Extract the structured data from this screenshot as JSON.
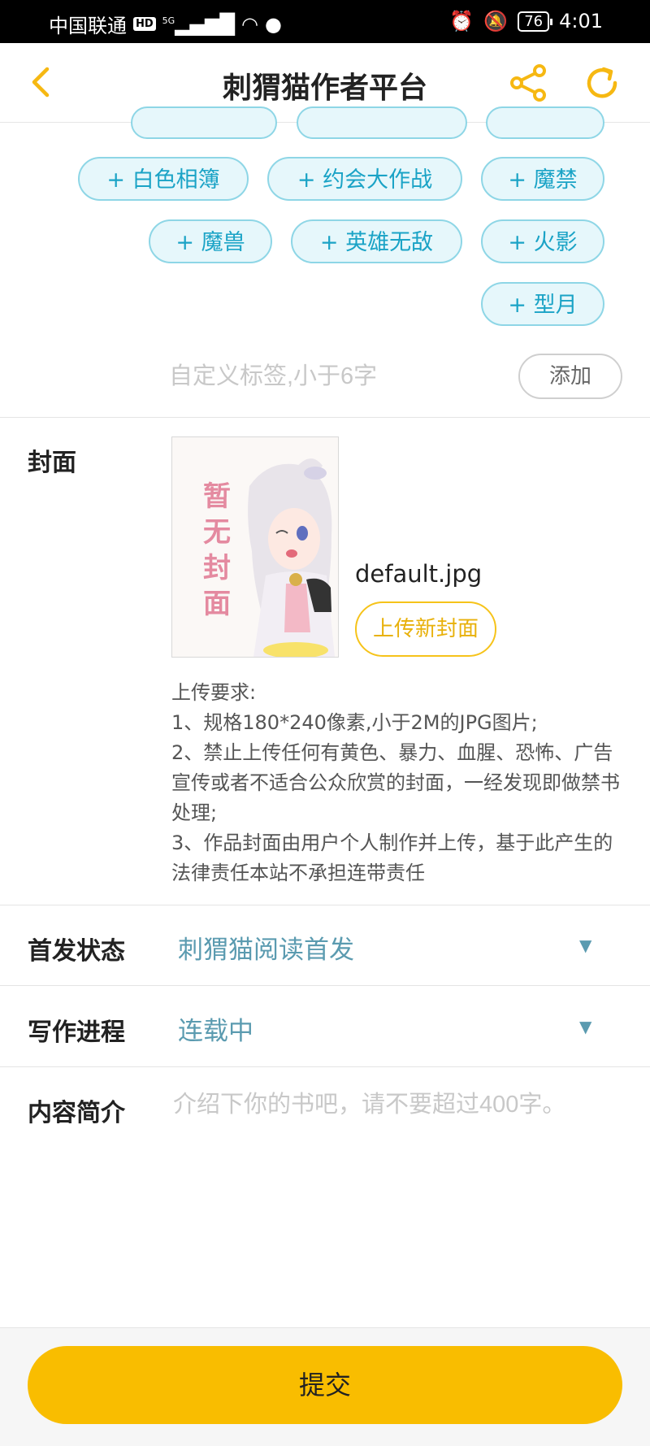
{
  "status_bar": {
    "carrier": "中国联通",
    "hd": "HD",
    "network": "5G",
    "battery": "76",
    "time": "4:01"
  },
  "header": {
    "title": "刺猬猫作者平台",
    "icons": [
      "chevron-left-icon",
      "share-icon",
      "refresh-icon"
    ],
    "accent_color": "#f6b812"
  },
  "tags": {
    "items": [
      "白色相簿",
      "约会大作战",
      "魔禁",
      "魔兽",
      "英雄无敌",
      "火影",
      "型月"
    ],
    "prefix": "+",
    "custom_placeholder": "自定义标签,小于6字",
    "add_label": "添加"
  },
  "cover": {
    "label": "封面",
    "placeholder_text": "暂无封面",
    "filename": "default.jpg",
    "upload_label": "上传新封面",
    "requirements": [
      "上传要求:",
      "1、规格180*240像素,小于2M的JPG图片;",
      "2、禁止上传任何有黄色、暴力、血腥、恐怖、广告宣传或者不适合公众欣赏的封面，一经发现即做禁书处理;",
      "3、作品封面由用户个人制作并上传，基于此产生的法律责任本站不承担连带责任"
    ]
  },
  "first_release": {
    "label": "首发状态",
    "value": "刺猬猫阅读首发"
  },
  "writing_progress": {
    "label": "写作进程",
    "value": "连载中"
  },
  "intro": {
    "label": "内容简介",
    "placeholder": "介绍下你的书吧，请不要超过400字。"
  },
  "submit_label": "提交"
}
